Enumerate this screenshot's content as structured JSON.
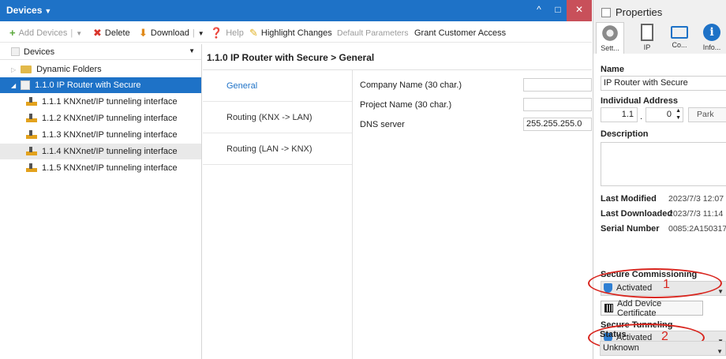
{
  "window": {
    "title": "Devices",
    "min_icon": "^",
    "max_icon": "□",
    "close_icon": "✕"
  },
  "toolbar": {
    "add_devices": "Add Devices",
    "delete": "Delete",
    "download": "Download",
    "help": "Help",
    "highlight_changes": "Highlight Changes",
    "default_parameters": "Default Parameters",
    "grant_customer_access": "Grant Customer Access"
  },
  "tree": {
    "header": "Devices",
    "items": [
      {
        "label": "Dynamic Folders"
      },
      {
        "label": "1.1.0 IP Router with Secure"
      },
      {
        "label": "1.1.1 KNXnet/IP tunneling interface"
      },
      {
        "label": "1.1.2 KNXnet/IP tunneling interface"
      },
      {
        "label": "1.1.3 KNXnet/IP tunneling interface"
      },
      {
        "label": "1.1.4 KNXnet/IP tunneling interface"
      },
      {
        "label": "1.1.5 KNXnet/IP tunneling interface"
      }
    ]
  },
  "center": {
    "breadcrumb": "1.1.0 IP Router with Secure  > General",
    "tabs": [
      "General",
      "Routing (KNX -> LAN)",
      "Routing (LAN -> KNX)"
    ],
    "params": [
      {
        "label": "Company Name (30 char.)",
        "value": ""
      },
      {
        "label": "Project Name (30 char.)",
        "value": ""
      },
      {
        "label": "DNS server",
        "value": "255.255.255.0"
      }
    ]
  },
  "properties": {
    "title": "Properties",
    "tabs": [
      "Sett...",
      "IP",
      "Co...",
      "Info..."
    ],
    "name_label": "Name",
    "name_value": "IP Router with Secure",
    "individual_address_label": "Individual Address",
    "ia_prefix": "1.1",
    "ia_dot": ".",
    "ia_suffix": "0",
    "park": "Park",
    "description_label": "Description",
    "last_modified_label": "Last Modified",
    "last_modified_value": "2023/7/3 12:07",
    "last_downloaded_label": "Last Downloaded",
    "last_downloaded_value": "2023/7/3 11:14",
    "serial_number_label": "Serial Number",
    "serial_number_value": "0085:2A150317",
    "secure_commissioning_label": "Secure Commissioning",
    "secure_commissioning_value": "Activated",
    "add_device_certificate": "Add Device Certificate",
    "secure_tunneling_label": "Secure Tunneling",
    "secure_tunneling_value": "Activated",
    "status_label": "Status",
    "status_value": "Unknown",
    "annotation_1": "1",
    "annotation_2": "2"
  },
  "colors": {
    "accent": "#1e72c7",
    "annotation": "#d8251e"
  }
}
